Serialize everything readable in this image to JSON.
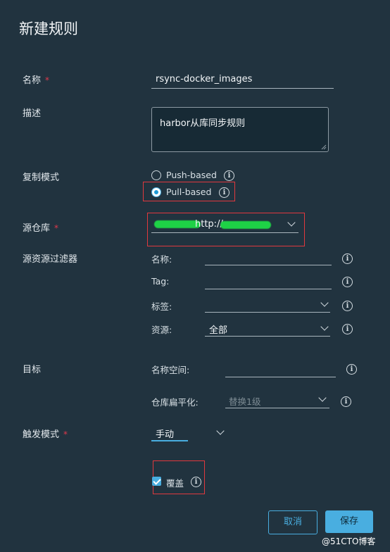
{
  "dialog": {
    "title": "新建规则"
  },
  "form": {
    "name": {
      "label": "名称",
      "required_mark": "*",
      "value": "rsync-docker_images"
    },
    "description": {
      "label": "描述",
      "value": "harbor从库同步规则"
    },
    "replication_mode": {
      "label": "复制模式",
      "options": [
        {
          "label": "Push-based",
          "selected": false
        },
        {
          "label": "Pull-based",
          "selected": true
        }
      ]
    },
    "source_registry": {
      "label": "源仓库",
      "required_mark": "*",
      "value_visible": "http://"
    },
    "source_filter": {
      "label": "源资源过滤器",
      "name_label": "名称:",
      "tag_label": "Tag:",
      "labels_label": "标签:",
      "resource_label": "资源:",
      "resource_value": "全部"
    },
    "destination": {
      "label": "目标",
      "namespace_label": "名称空间:",
      "flatten_label": "仓库扁平化:",
      "flatten_value": "替换1级"
    },
    "trigger": {
      "label": "触发模式",
      "required_mark": "*",
      "value": "手动"
    },
    "override": {
      "label": "覆盖",
      "checked": true
    }
  },
  "buttons": {
    "cancel": "取消",
    "save": "保存"
  },
  "watermark": "@51CTO博客",
  "colors": {
    "background": "#21333f",
    "accent": "#49aee0",
    "required": "#e0394c",
    "highlight_box": "#e0393e",
    "redaction": "#1ed246"
  },
  "icons": [
    "info-icon",
    "chevron-down-icon",
    "checkbox-checked-icon",
    "radio-icon"
  ]
}
